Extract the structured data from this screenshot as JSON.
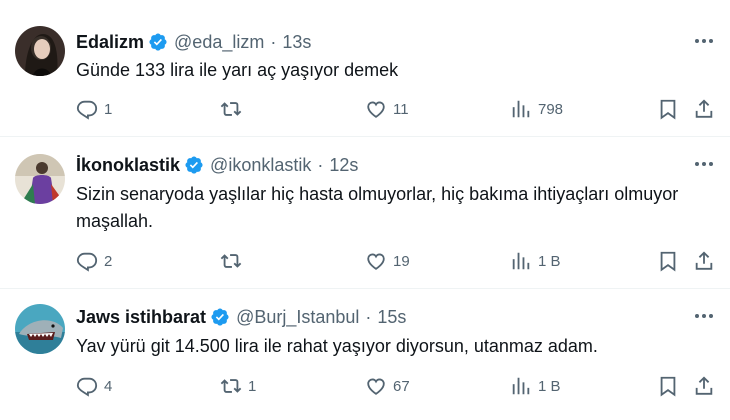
{
  "tweets": [
    {
      "name": "Edalizm",
      "handle": "@eda_lizm",
      "separator": "·",
      "time": "13s",
      "text": "Günde 133 lira ile yarı aç yaşıyor demek",
      "replies": "1",
      "retweets": "",
      "likes": "11",
      "views": "798"
    },
    {
      "name": "İkonoklastik",
      "handle": "@ikonklastik",
      "separator": "·",
      "time": "12s",
      "text": "Sizin senaryoda yaşlılar hiç hasta olmuyorlar, hiç bakıma ihtiyaçları olmuyor maşallah.",
      "replies": "2",
      "retweets": "",
      "likes": "19",
      "views": "1 B"
    },
    {
      "name": "Jaws istihbarat",
      "handle": "@Burj_Istanbul",
      "separator": "·",
      "time": "15s",
      "text": "Yav yürü git 14.500 lira ile rahat yaşıyor diyorsun, utanmaz adam.",
      "replies": "4",
      "retweets": "1",
      "likes": "67",
      "views": "1 B"
    }
  ],
  "colors": {
    "text": "#0f1419",
    "secondary": "#536471",
    "verified": "#1d9bf0",
    "divider": "#eff3f4"
  },
  "icons": {
    "reply": "reply-icon",
    "retweet": "retweet-icon",
    "like": "heart-icon",
    "views": "views-icon",
    "bookmark": "bookmark-icon",
    "share": "share-icon",
    "more": "more-icon",
    "verified": "verified-badge-icon"
  }
}
